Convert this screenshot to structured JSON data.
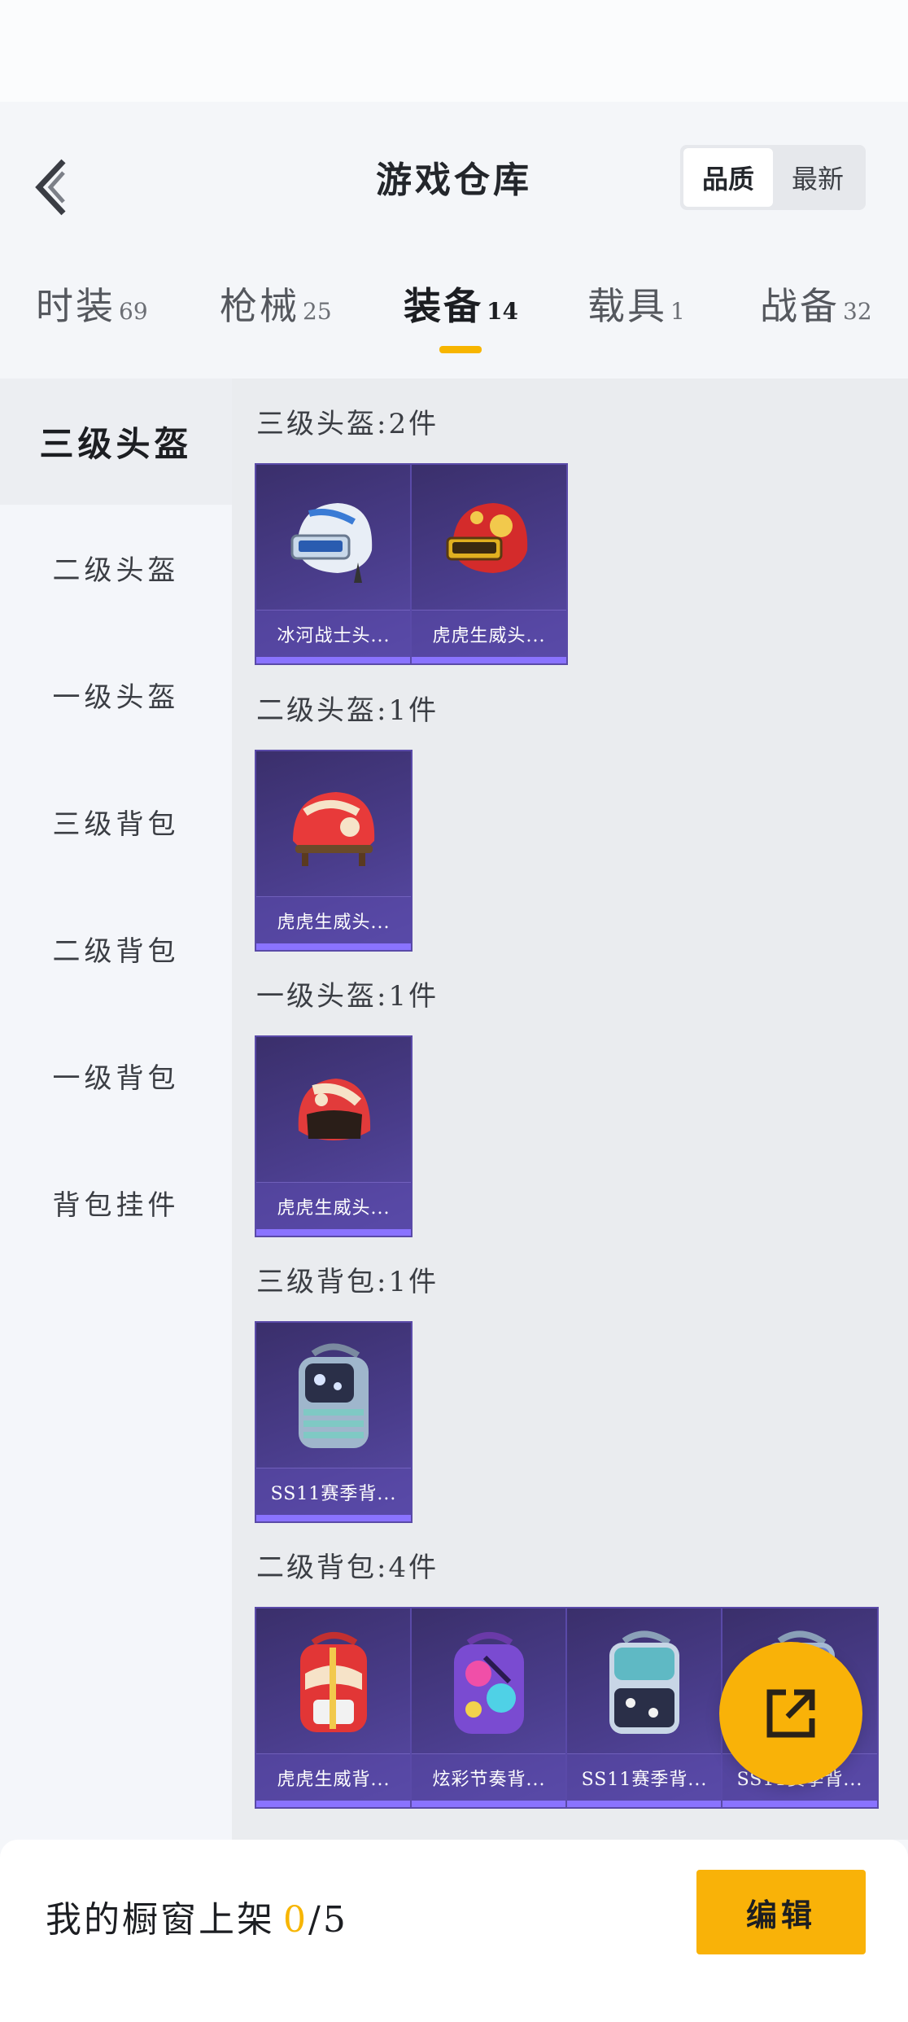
{
  "header": {
    "title": "游戏仓库",
    "sort_options": [
      "品质",
      "最新"
    ],
    "sort_active": "品质"
  },
  "tabs": [
    {
      "label": "时装",
      "count": "69"
    },
    {
      "label": "枪械",
      "count": "25"
    },
    {
      "label": "装备",
      "count": "14",
      "active": true
    },
    {
      "label": "载具",
      "count": "1"
    },
    {
      "label": "战备",
      "count": "32"
    }
  ],
  "sidebar": {
    "items": [
      "三级头盔",
      "二级头盔",
      "一级头盔",
      "三级背包",
      "二级背包",
      "一级背包",
      "背包挂件"
    ],
    "active": "三级头盔"
  },
  "sections": [
    {
      "title": "三级头盔:2件",
      "items": [
        {
          "name": "冰河战士头...",
          "icon": "helmet-icon"
        },
        {
          "name": "虎虎生威头...",
          "icon": "helmet-icon"
        }
      ]
    },
    {
      "title": "二级头盔:1件",
      "items": [
        {
          "name": "虎虎生威头...",
          "icon": "helmet-icon"
        }
      ]
    },
    {
      "title": "一级头盔:1件",
      "items": [
        {
          "name": "虎虎生威头...",
          "icon": "helmet-icon"
        }
      ]
    },
    {
      "title": "三级背包:1件",
      "items": [
        {
          "name": "SS11赛季背...",
          "icon": "backpack-icon"
        }
      ]
    },
    {
      "title": "二级背包:4件",
      "items": [
        {
          "name": "虎虎生威背...",
          "icon": "backpack-icon"
        },
        {
          "name": "炫彩节奏背...",
          "icon": "backpack-icon"
        },
        {
          "name": "SS11赛季背...",
          "icon": "backpack-icon"
        },
        {
          "name": "SS11赛季背...",
          "icon": "backpack-icon"
        }
      ]
    }
  ],
  "bottom": {
    "shelf_label": "我的橱窗上架",
    "shelf_current": "0",
    "shelf_total": "/5",
    "edit_label": "编辑"
  },
  "colors": {
    "accent": "#f7b500",
    "card_bg": "#4a3d8c"
  }
}
